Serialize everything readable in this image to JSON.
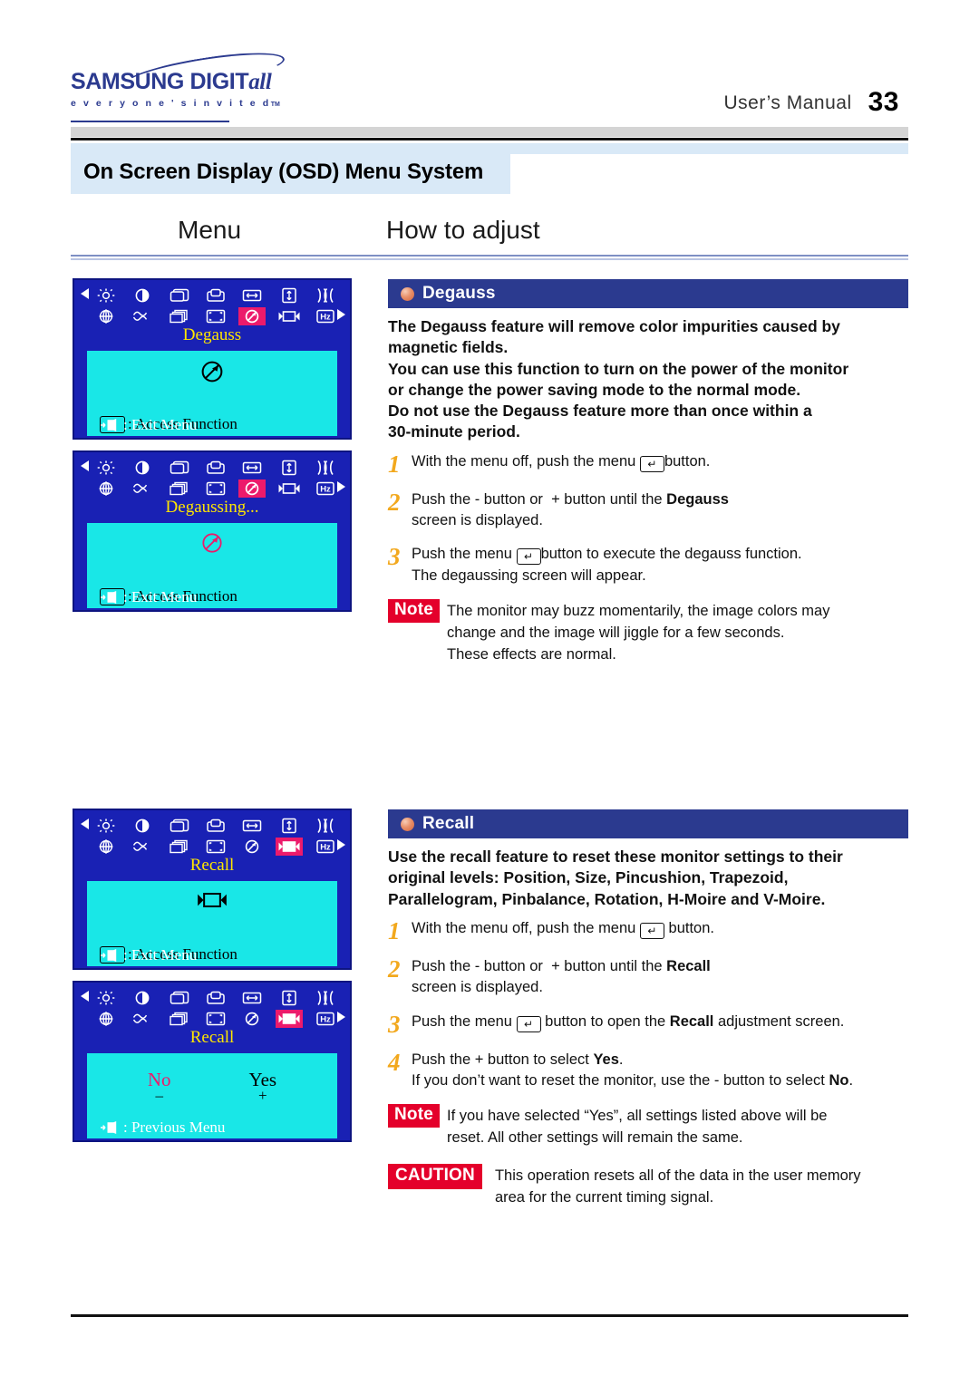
{
  "header": {
    "brand_main": "SAMSUNG DIGIT",
    "brand_main_italic": "all",
    "brand_sub": "e v e r y o n e ' s   i n v i t e d",
    "brand_tm": "TM",
    "manual_label": "User’s Manual",
    "page_number": "33"
  },
  "section": {
    "title": "On Screen Display (OSD) Menu System",
    "col_menu": "Menu",
    "col_how": "How to adjust"
  },
  "osd_panels": [
    {
      "title": "Degauss",
      "selected_icon": "degauss-icon",
      "body_icon": "degauss-icon",
      "access_label": ": Access Function",
      "exit_label": ": Exit Menu"
    },
    {
      "title": "Degaussing...",
      "selected_icon": "degauss-icon",
      "body_icon": "degauss-icon-pink",
      "access_label": ": Access Function",
      "exit_label": ": Exit Menu"
    },
    {
      "title": "Recall",
      "selected_icon": "recall-icon",
      "body_icon": "recall-icon",
      "access_label": ": Access Function",
      "exit_label": ": Exit Menu"
    },
    {
      "title": "Recall",
      "selected_icon": "recall-icon",
      "option_no": "No",
      "option_no_sign": "–",
      "option_yes": "Yes",
      "option_yes_sign": "+",
      "exit_label": ": Previous Menu"
    }
  ],
  "degauss": {
    "heading": "Degauss",
    "description": "The Degauss feature will remove color impurities caused by magnetic fields.\nYou can use this function to turn on the power of the monitor or change the power saving mode to the normal mode.\nDo not use the Degauss feature more than once within a 30-minute period.",
    "steps": [
      {
        "num": "1",
        "pre": "With the menu off, push the menu ",
        "key": "↵",
        "post": "button."
      },
      {
        "num": "2",
        "pre": "Push the - button or  + button until the ",
        "bold": "Degauss",
        "post": "",
        "line2": "screen is displayed."
      },
      {
        "num": "3",
        "pre": "Push the menu ",
        "key": "↵",
        "post": "button to execute the degauss function.",
        "line2": "The degaussing screen will appear."
      }
    ],
    "note_tag": "Note",
    "note_text": "The monitor may buzz momentarily, the image colors may change and the image will jiggle for a few seconds.\nThese effects are normal."
  },
  "recall": {
    "heading": "Recall",
    "description": "Use the recall feature to reset these monitor settings to their original levels: Position, Size, Pincushion, Trapezoid, Parallelogram, Pinbalance, Rotation, H-Moire and V-Moire.",
    "steps": [
      {
        "num": "1",
        "pre": "With the menu off, push the menu ",
        "key": "↵",
        "post": " button."
      },
      {
        "num": "2",
        "pre": "Push the - button or  + button until the ",
        "bold": "Recall",
        "post": "",
        "line2": "screen is displayed."
      },
      {
        "num": "3",
        "pre": "Push the menu ",
        "key": "↵",
        "post": " button to open the ",
        "bold2": "Recall",
        "post2": " adjustment screen."
      },
      {
        "num": "4",
        "pre": "Push the + button to select ",
        "bold": "Yes",
        "post": ".",
        "line2_pre": "If you don’t want to reset the monitor, use the - button to select ",
        "line2_bold": "No",
        "line2_post": "."
      }
    ],
    "note_tag": "Note",
    "note_text": "If you have selected “Yes”, all settings listed above will be reset. All other settings will remain the same.",
    "caution_tag": "CAUTION",
    "caution_text": "This operation resets all of the data in the user memory area for the current timing signal."
  },
  "icon_names_row1": [
    "brightness-icon",
    "contrast-icon",
    "h-position-icon",
    "v-position-icon",
    "h-size-icon",
    "v-size-icon",
    "pincushion-icon"
  ],
  "icon_names_row2": [
    "rotation-icon",
    "trapezoid-icon",
    "parallelogram-icon",
    "pinbalance-icon",
    "degauss-icon",
    "recall-icon",
    "hz-icon"
  ],
  "colors": {
    "osd_blue": "#1921b4",
    "osd_cyan": "#19e7e7",
    "osd_highlight": "#ec1a6b",
    "osd_title_yellow": "#ffe600",
    "section_bar": "#2b3a8f",
    "brand_blue": "#2b3a8f",
    "note_red": "#e4002b",
    "step_number": "#f2a81d",
    "band_light_blue": "#d9e9f7"
  }
}
